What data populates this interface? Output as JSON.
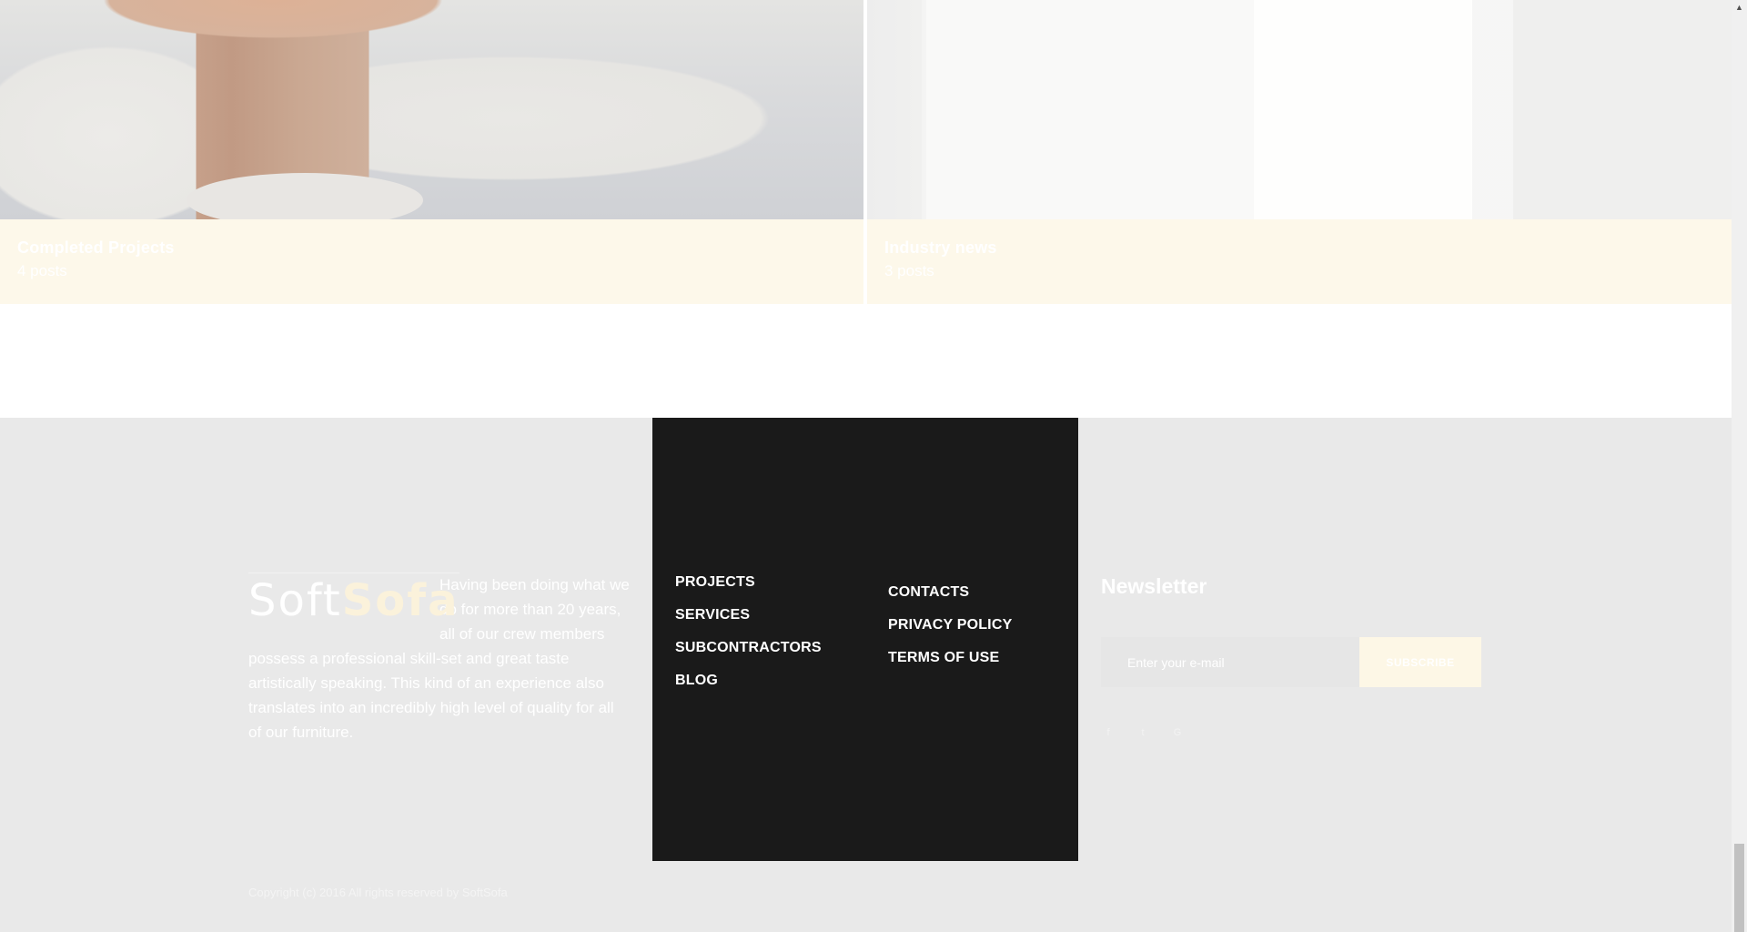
{
  "categories": [
    {
      "title": "Completed Projects",
      "count": "4 posts"
    },
    {
      "title": "Industry news",
      "count": "3 posts"
    }
  ],
  "footer": {
    "logo": {
      "part1": "Soft",
      "part2": "Sofa"
    },
    "about": "Having been doing what we do for more than 20 years, all of our crew members possess a professional skill-set and great taste artistically speaking. This kind of an experience also translates into an incredibly high level of quality for all of our furniture.",
    "menu_primary": [
      "PROJECTS",
      "SERVICES",
      "SUBCONTRACTORS",
      "BLOG"
    ],
    "menu_secondary": [
      "CONTACTS",
      "PRIVACY POLICY",
      "TERMS OF USE"
    ],
    "newsletter": {
      "title": "Newsletter",
      "placeholder": "Enter your e-mail",
      "button": "SUBSCRIBE"
    },
    "socials": [
      {
        "icon": "facebook-icon",
        "glyph": "f"
      },
      {
        "icon": "twitter-icon",
        "glyph": "t"
      },
      {
        "icon": "google-plus-icon",
        "glyph": "G"
      }
    ],
    "copyright": "Copyright (c) 2016 All rights reserved by SoftSofa"
  },
  "colors": {
    "footer_bg": "#e9e9e9",
    "menu_bg": "#1a1a1a",
    "accent_cream": "#fdf7e6"
  }
}
